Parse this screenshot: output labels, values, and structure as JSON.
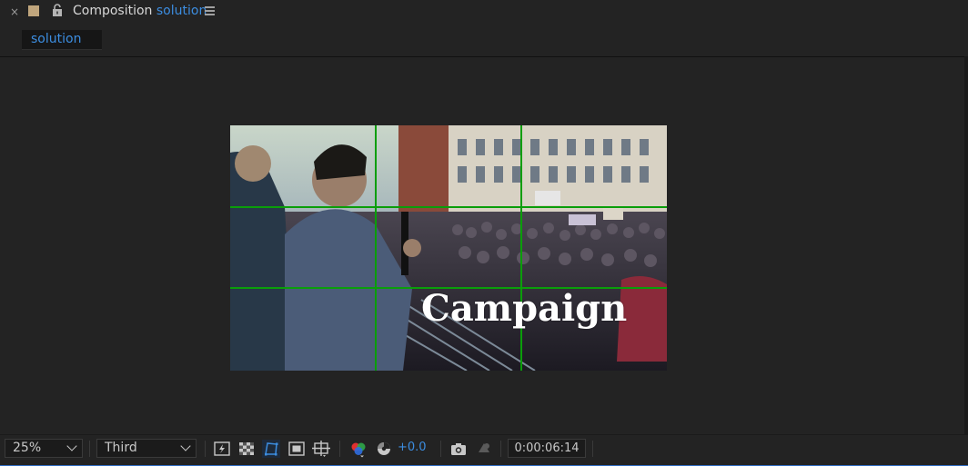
{
  "header": {
    "close_glyph": "×",
    "title_prefix": "Composition",
    "comp_name": "solution",
    "swatch_color": "#c0a67d"
  },
  "tab": {
    "label": "solution"
  },
  "viewer": {
    "caption": "Campaign",
    "grid_color": "#0a9e0a"
  },
  "toolbar": {
    "zoom": "25%",
    "resolution": "Third",
    "exposure": "+0.0",
    "timecode": "0:00:06:14",
    "icons": [
      "fast-previews-icon",
      "transparency-grid-icon",
      "mask-path-visibility-icon",
      "region-of-interest-icon",
      "grid-guides-icon",
      "channel-icon",
      "reset-exposure-icon",
      "snapshot-icon",
      "show-snapshot-icon"
    ]
  }
}
